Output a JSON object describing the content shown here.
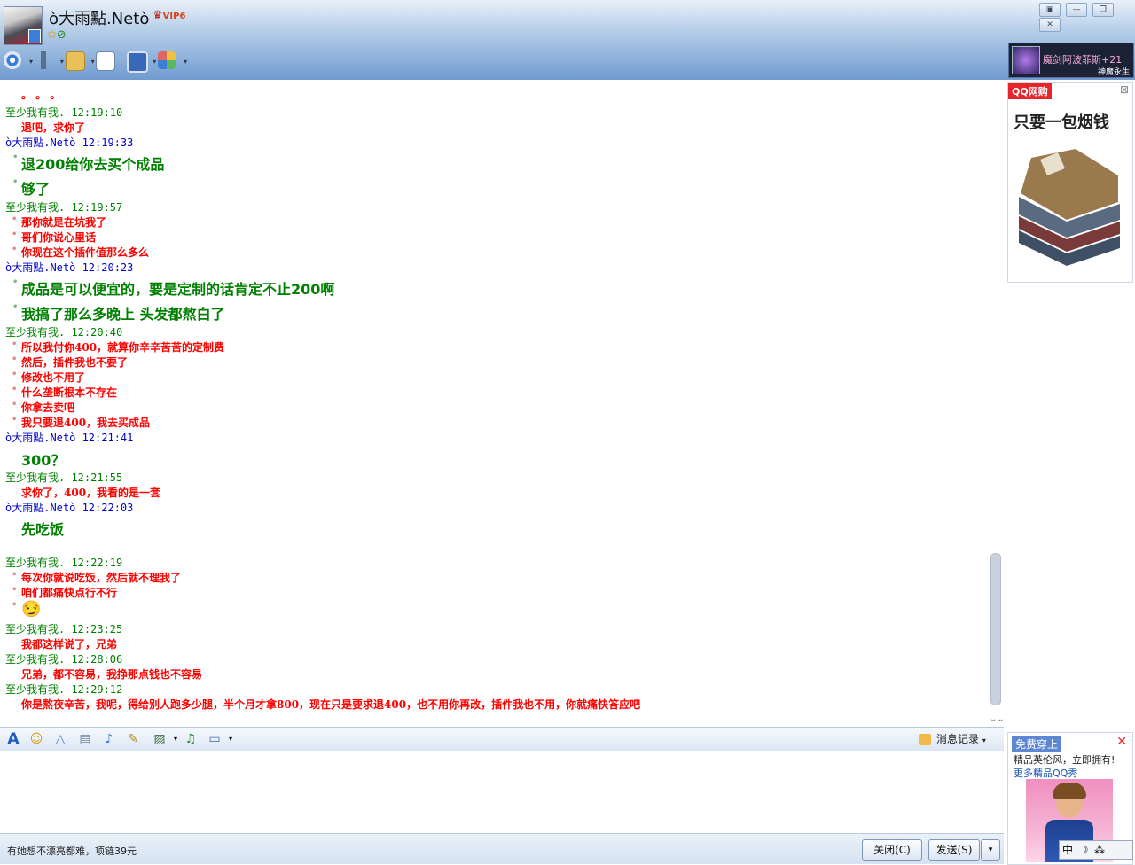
{
  "header": {
    "title": "ò大雨點.Netò",
    "vip_label": "VIP6",
    "toolbar_icons": [
      "video-call-icon",
      "voice-call-icon",
      "file-transfer-icon",
      "create-discussion-icon",
      "remote-desktop-icon",
      "apps-icon"
    ]
  },
  "window_controls": [
    "▣",
    "—",
    "❐",
    "✕"
  ],
  "game_ad": {
    "text": "魔剑阿波菲斯+21",
    "subtext": "神魔永生"
  },
  "shop_ad": {
    "tag": "QQ网购",
    "slogan": "只要一包烟钱"
  },
  "chat": [
    {
      "kind": "red",
      "text": "。 。 。",
      "bullet": false
    },
    {
      "kind": "hdr-me",
      "text": "至少我有我.  12:19:10"
    },
    {
      "kind": "red",
      "text": "退吧，求你了",
      "bullet": false
    },
    {
      "kind": "hdr-other",
      "text": "ò大雨點.Netò  12:19:33"
    },
    {
      "kind": "green",
      "text": "退200给你去买个成品",
      "bullet": true
    },
    {
      "kind": "green",
      "text": "够了",
      "bullet": true
    },
    {
      "kind": "hdr-me",
      "text": "至少我有我.  12:19:57"
    },
    {
      "kind": "red",
      "text": "那你就是在坑我了",
      "bullet": true
    },
    {
      "kind": "red",
      "text": "哥们你说心里话",
      "bullet": true
    },
    {
      "kind": "red",
      "text": "你现在这个插件值那么多么",
      "bullet": true
    },
    {
      "kind": "hdr-other",
      "text": "ò大雨點.Netò  12:20:23"
    },
    {
      "kind": "green",
      "text": "成品是可以便宜的，要是定制的话肯定不止200啊",
      "bullet": true
    },
    {
      "kind": "green",
      "text": "我搞了那么多晚上 头发都熬白了",
      "bullet": true
    },
    {
      "kind": "hdr-me",
      "text": "至少我有我.  12:20:40"
    },
    {
      "kind": "red",
      "text": "所以我付你400，就算你辛辛苦苦的定制费",
      "bullet": true
    },
    {
      "kind": "red",
      "text": "然后，插件我也不要了",
      "bullet": true
    },
    {
      "kind": "red",
      "text": "修改也不用了",
      "bullet": true
    },
    {
      "kind": "red",
      "text": "什么垄断根本不存在",
      "bullet": true
    },
    {
      "kind": "red",
      "text": "你拿去卖吧",
      "bullet": true
    },
    {
      "kind": "red",
      "text": "我只要退400，我去买成品",
      "bullet": true
    },
    {
      "kind": "hdr-other",
      "text": "ò大雨點.Netò  12:21:41"
    },
    {
      "kind": "green",
      "text": "300？",
      "bullet": false
    },
    {
      "kind": "hdr-me",
      "text": "至少我有我.  12:21:55"
    },
    {
      "kind": "red",
      "text": "求你了，400，我看的是一套",
      "bullet": false
    },
    {
      "kind": "hdr-other",
      "text": "ò大雨點.Netò  12:22:03"
    },
    {
      "kind": "green",
      "text": "先吃饭",
      "bullet": false
    },
    {
      "kind": "hdr-me",
      "text": "至少我有我.  12:22:19"
    },
    {
      "kind": "red",
      "text": "每次你就说吃饭，然后就不理我了",
      "bullet": true
    },
    {
      "kind": "red",
      "text": "咱们都痛快点行不行",
      "bullet": true
    },
    {
      "kind": "emoji",
      "text": "😏",
      "bullet": true
    },
    {
      "kind": "hdr-me",
      "text": "至少我有我.  12:23:25"
    },
    {
      "kind": "red",
      "text": "我都这样说了，兄弟",
      "bullet": false
    },
    {
      "kind": "hdr-me",
      "text": "至少我有我.  12:28:06"
    },
    {
      "kind": "red",
      "text": "兄弟，都不容易，我挣那点钱也不容易",
      "bullet": false
    },
    {
      "kind": "hdr-me",
      "text": "至少我有我.  12:29:12"
    },
    {
      "kind": "red",
      "text": "你是熬夜辛苦，我呢，得给别人跑多少腿，半个月才拿800，现在只是要求退400，也不用你再改，插件我也不用，你就痛快答应吧",
      "bullet": false
    }
  ],
  "input_toolbar": {
    "history_label": "消息记录"
  },
  "bottom": {
    "tip": "有她想不漂亮都难，项链39元",
    "close_label": "关闭(C)",
    "send_label": "发送(S)"
  },
  "show_ad": {
    "tag": "免费穿上",
    "line1": "精品英伦风，立即拥有!",
    "line2": "更多精品QQ秀"
  },
  "ime": {
    "mode": "中",
    "icons": [
      "☽",
      "⁂"
    ]
  }
}
